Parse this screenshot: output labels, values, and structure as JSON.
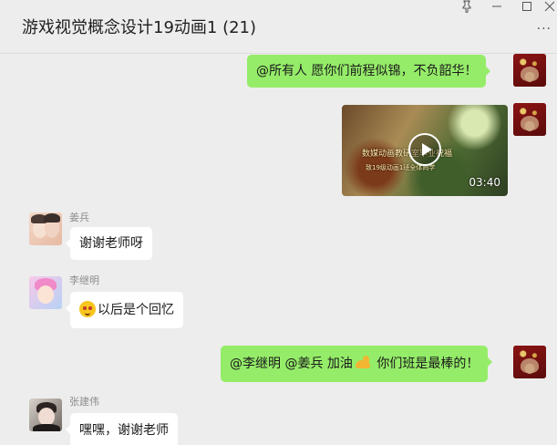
{
  "header": {
    "title": "游戏视觉概念设计19动画1 (21)",
    "pin_icon": "pin-icon",
    "minimize_icon": "minimize-icon",
    "maximize_icon": "maximize-icon",
    "close_icon": "close-icon",
    "more_label": "···"
  },
  "messages": [
    {
      "sender": "me",
      "text": "@所有人 愿你们前程似锦，不负韶华！"
    },
    {
      "sender": "me",
      "type": "video",
      "video_text": "数媒动画教研室毕业祝福",
      "video_subtext": "致19级动画1班全体同学",
      "duration": "03:40"
    },
    {
      "sender": "姜兵",
      "text": "谢谢老师呀"
    },
    {
      "sender": "李继明",
      "text": "以后是个回忆"
    },
    {
      "sender": "me",
      "text_before": "@李继明 @姜兵 加油",
      "text_after": " 你们班是最棒的！"
    },
    {
      "sender": "张建伟",
      "text": "嘿嘿，谢谢老师"
    }
  ],
  "colors": {
    "background": "#ededed",
    "sent_bubble": "#95ec69",
    "received_bubble": "#ffffff"
  }
}
